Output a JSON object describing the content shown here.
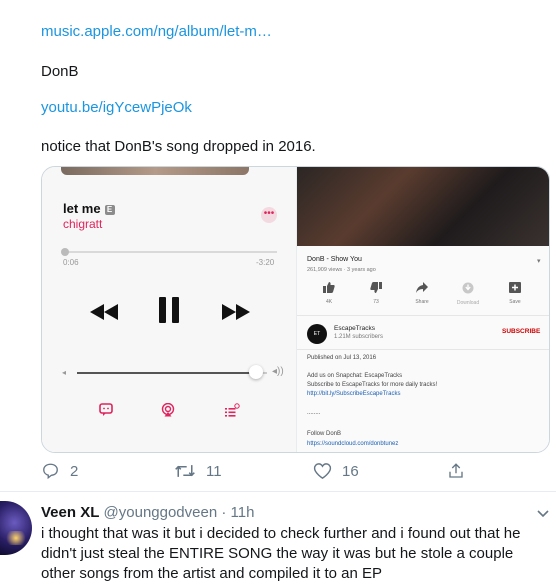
{
  "tweet": {
    "lines": {
      "apple_link": "music.apple.com/ng/album/let-m…",
      "donb": "DonB",
      "youtube_link": "youtu.be/igYcewPjeOk",
      "notice": "notice that DonB's song dropped in 2016."
    },
    "apple_music": {
      "song_title": "let me",
      "explicit_badge": "E",
      "artist": "chigratt",
      "time_elapsed": "0:06",
      "time_remaining": "-3:20",
      "progress_fraction": 0.03,
      "volume_fraction": 0.9
    },
    "youtube": {
      "title": "DonB - Show You",
      "views": "261,909 views · 3 years ago",
      "actions": [
        {
          "icon": "thumbs-up-icon",
          "label": "4K"
        },
        {
          "icon": "thumbs-down-icon",
          "label": "73"
        },
        {
          "icon": "share-icon",
          "label": "Share"
        },
        {
          "icon": "download-icon",
          "label": "Download"
        },
        {
          "icon": "save-icon",
          "label": "Save"
        }
      ],
      "channel_name": "EscapeTracks",
      "channel_subs": "1.21M subscribers",
      "subscribe_label": "SUBSCRIBE",
      "published": "Published on Jul 13, 2016",
      "desc_line1": "Add us on Snapchat: EscapeTracks",
      "desc_line2": "Subscribe to EscapeTracks for more daily tracks!",
      "desc_link1": "http://bit.ly/SubscribeEscapeTracks",
      "desc_dots": "........",
      "follow": "Follow DonB",
      "desc_link2": "https://soundcloud.com/donbtunez"
    },
    "stats": {
      "replies": "2",
      "retweets": "11",
      "likes": "16"
    }
  },
  "reply": {
    "display_name": "Veen XL",
    "handle_time": "@younggodveen · 11h",
    "text": "i thought that was it but i decided to check further and i found out that he didn't just steal the ENTIRE SONG the way it was but he stole a couple other songs from the artist and compiled it to an EP"
  },
  "colors": {
    "link": "#1b95e0",
    "accent_pink": "#e0245e",
    "muted": "#657786",
    "youtube_red": "#cc0000"
  }
}
